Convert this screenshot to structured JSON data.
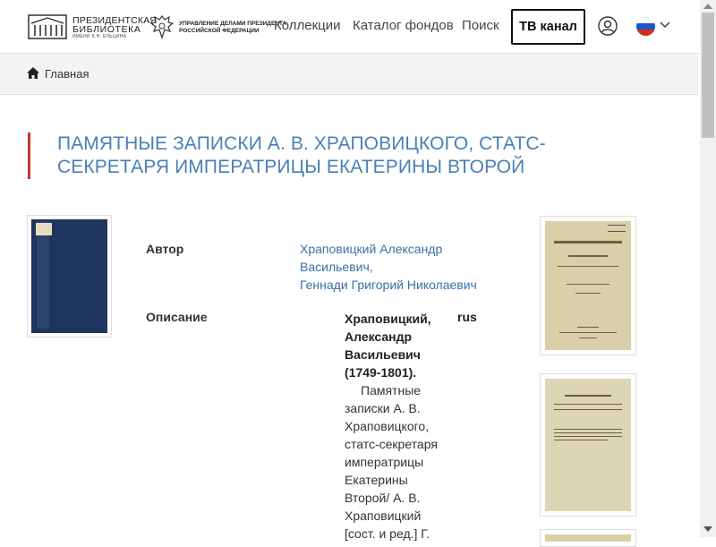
{
  "header": {
    "logo_library": {
      "line1": "ПРЕЗИДЕНТСКАЯ",
      "line2": "БИБЛИОТЕКА",
      "line3": "ИМЕНИ Б.Н. ЕЛЬЦИНА"
    },
    "logo_admin": {
      "line1": "УПРАВЛЕНИЕ ДЕЛАМИ ПРЕЗИДЕНТА",
      "line2": "РОССИЙСКОЙ ФЕДЕРАЦИИ"
    },
    "nav": {
      "collections": "Коллекции",
      "catalog": "Каталог фондов",
      "search": "Поиск"
    },
    "tv_button": "ТВ канал",
    "icons": {
      "user": "user-circle-icon",
      "language": "russian-flag-icon",
      "dropdown": "chevron-down-icon"
    }
  },
  "breadcrumb": {
    "home_label": "Главная"
  },
  "document": {
    "title": "ПАМЯТНЫЕ ЗАПИСКИ А. В. ХРАПОВИЦКОГО, СТАТС-СЕКРЕТАРЯ ИМПЕРАТРИЦЫ ЕКАТЕРИНЫ ВТОРОЙ",
    "author_label": "Автор",
    "authors": [
      "Храповицкий Александр",
      "Васильевич,",
      "Геннади Григорий Николаевич"
    ],
    "description_label": "Описание",
    "description_heading": "Храповицкий, Александр Васильевич (1749-1801).",
    "description_lang": "rus",
    "description_text": "Памятные записки А. В. Храповицкого, статс-секретаря императрицы Екатерины Второй/ А. В. Храповицкий [сост. и ред.] Г."
  },
  "colors": {
    "accent_red": "#c0392b",
    "title_blue": "#4a7fb5",
    "link_blue": "#3a6fa8"
  }
}
